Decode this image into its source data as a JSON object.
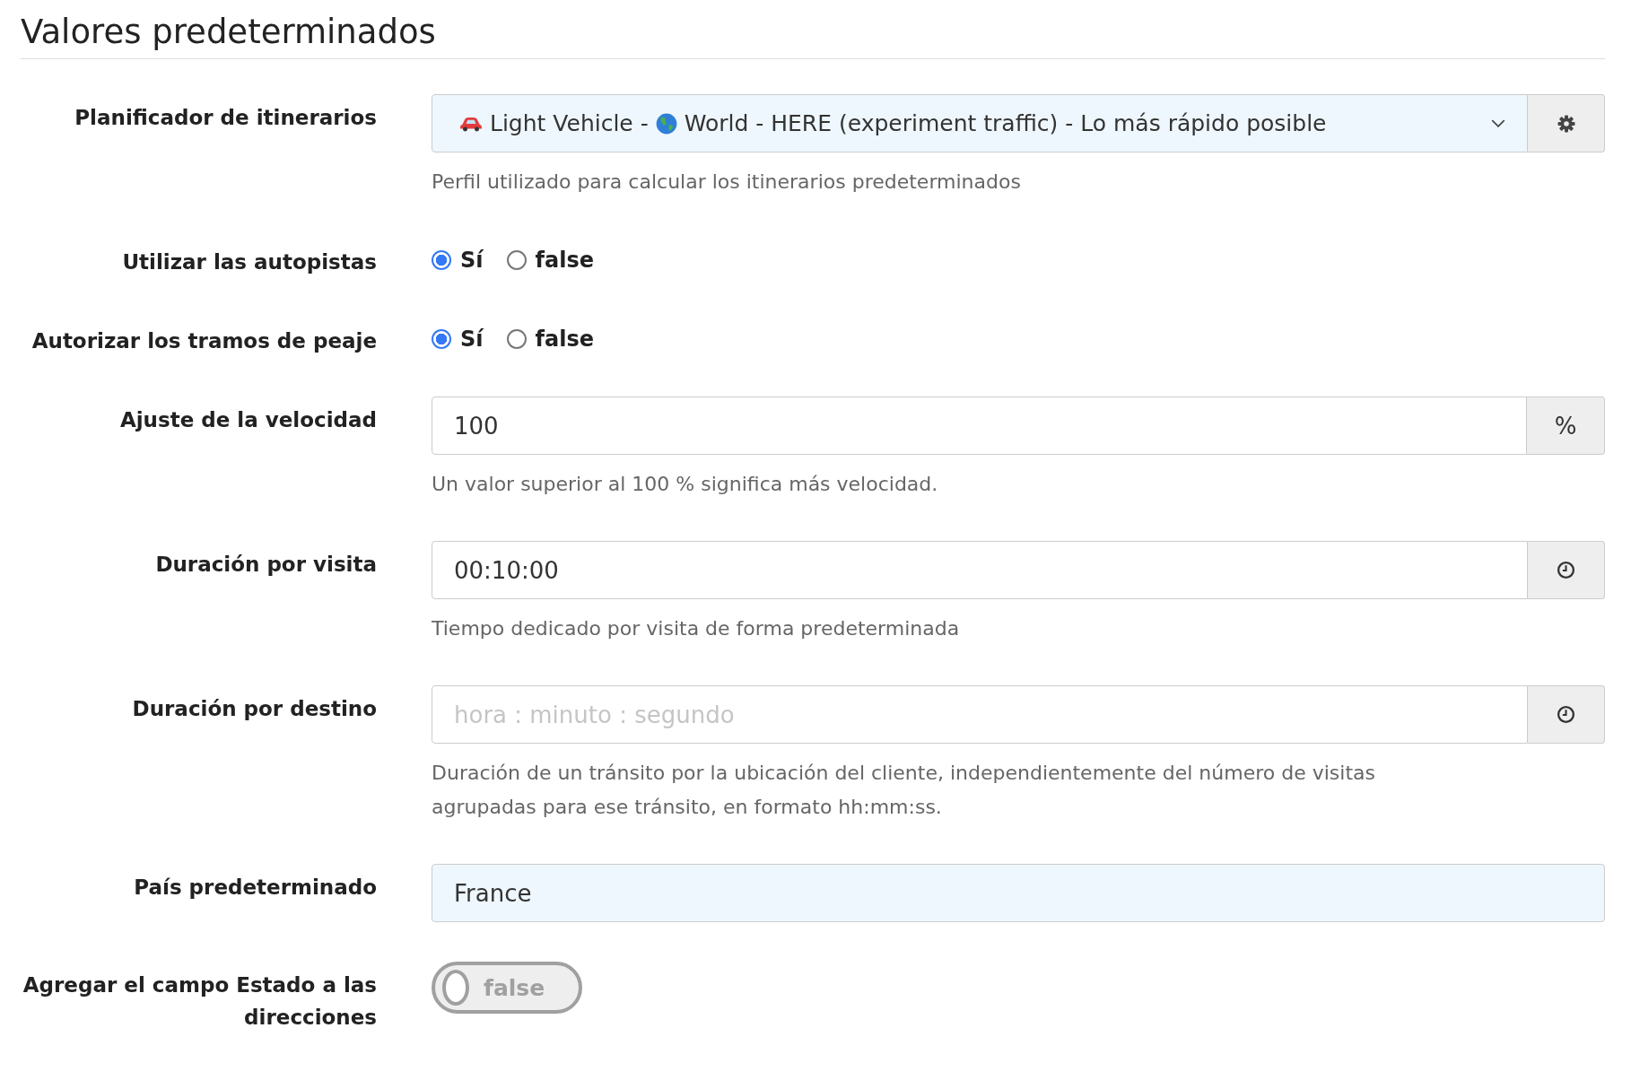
{
  "title": "Valores predeterminados",
  "fields": [
    {
      "kind": "select",
      "label": "Planificador de itinerarios",
      "segments": [
        "Light Vehicle -",
        "World - HERE (experiment traffic) - Lo más rápido posible"
      ],
      "help": [
        "Perfil utilizado para calcular los itinerarios predeterminados"
      ]
    },
    {
      "kind": "radio",
      "label": "Utilizar las autopistas",
      "options": [
        {
          "label": "Sí",
          "selected": true
        },
        {
          "label": "false",
          "selected": false
        }
      ]
    },
    {
      "kind": "radio",
      "label": "Autorizar los tramos de peaje",
      "options": [
        {
          "label": "Sí",
          "selected": true
        },
        {
          "label": "false",
          "selected": false
        }
      ]
    },
    {
      "kind": "input",
      "label": "Ajuste de la velocidad",
      "value": "100",
      "addon": "%",
      "help": [
        "Un valor superior al 100 % significa más velocidad."
      ]
    },
    {
      "kind": "time",
      "label": "Duración por visita",
      "value": "00:10:00",
      "help": [
        "Tiempo dedicado por visita de forma predeterminada"
      ]
    },
    {
      "kind": "time",
      "label": "Duración por destino",
      "placeholder": "hora : minuto : segundo",
      "help": [
        "Duración de un tránsito por la ubicación del cliente, independientemente del número de visitas",
        "agrupadas para ese tránsito, en formato hh:mm:ss."
      ]
    },
    {
      "kind": "country",
      "label": "País predeterminado",
      "value": "France"
    },
    {
      "kind": "toggle",
      "label": "Agregar el campo Estado a las direcciones",
      "on": false,
      "text": "false"
    }
  ]
}
